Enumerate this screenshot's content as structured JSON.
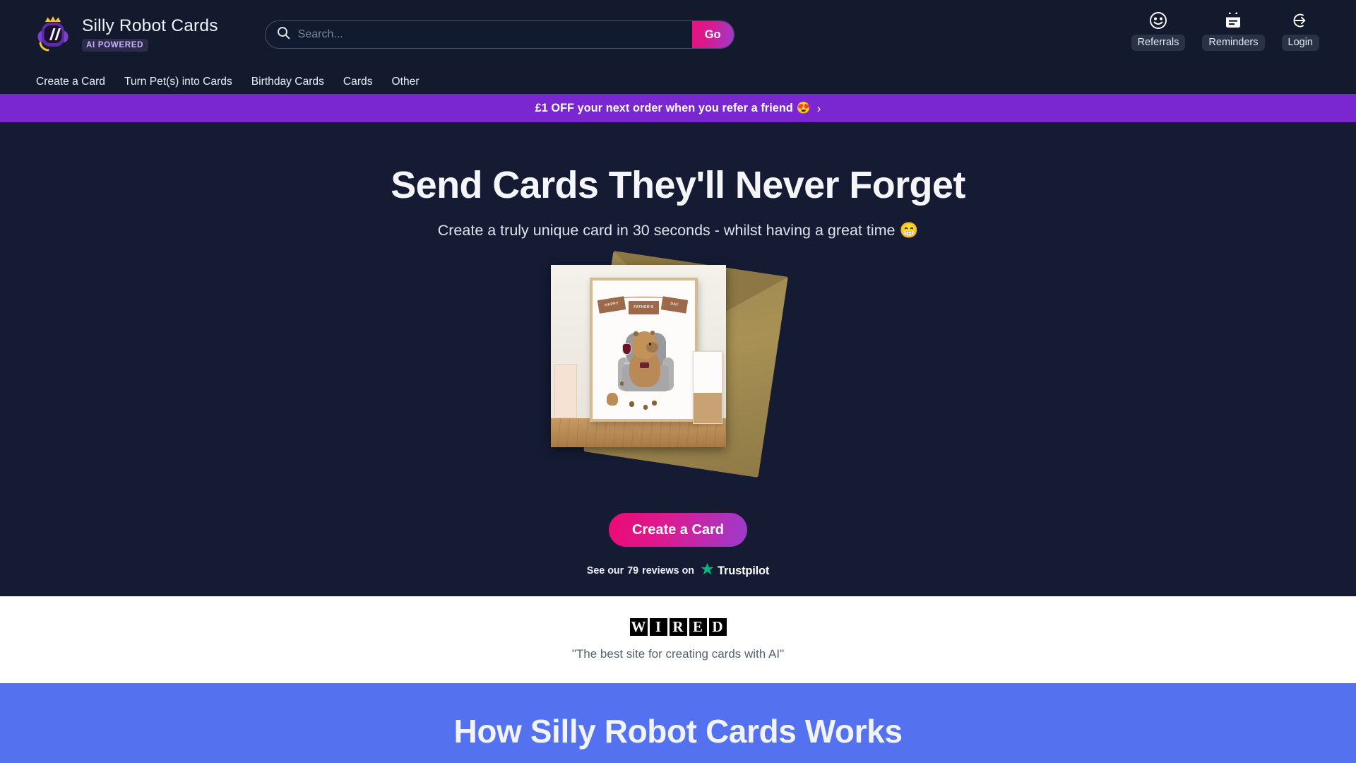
{
  "brand": {
    "name": "Silly Robot Cards",
    "badge": "AI POWERED",
    "logo_icon": "robot-crown-logo"
  },
  "search": {
    "placeholder": "Search...",
    "value": "",
    "submit_label": "Go",
    "icon": "search-icon"
  },
  "header_actions": [
    {
      "label": "Referrals",
      "icon": "smiley-face-icon"
    },
    {
      "label": "Reminders",
      "icon": "calendar-note-icon"
    },
    {
      "label": "Login",
      "icon": "login-arrow-icon"
    }
  ],
  "nav": {
    "items": [
      {
        "label": "Create a Card"
      },
      {
        "label": "Turn Pet(s) into Cards"
      },
      {
        "label": "Birthday Cards"
      },
      {
        "label": "Cards"
      },
      {
        "label": "Other"
      }
    ]
  },
  "promo": {
    "text": "£1 OFF your next order when you refer a friend 😍",
    "chevron": "›",
    "background": "#7a27d2"
  },
  "hero": {
    "title": "Send Cards They'll Never Forget",
    "subtitle": "Create a truly unique card in 30 seconds - whilst having a great time 😁",
    "cta_label": "Create a Card",
    "background": "#141b33",
    "cta_gradient_from": "#ec0a75",
    "cta_gradient_to": "#9b3ccd",
    "artwork": {
      "description": "capybara-fathers-day-card",
      "banner_flags": [
        "HAPPY",
        "FATHER'S",
        "DAY"
      ],
      "envelope_color": "#a89154"
    }
  },
  "trustpilot": {
    "prefix": "See our",
    "count": "79",
    "suffix": "reviews on",
    "brand": "Trustpilot",
    "star_color": "#00b67a"
  },
  "press": {
    "logo_letters": [
      "W",
      "I",
      "R",
      "E",
      "D"
    ],
    "quote": "\"The best site for creating cards with AI\""
  },
  "how_section": {
    "title": "How Silly Robot Cards Works",
    "background": "#5471ef"
  }
}
